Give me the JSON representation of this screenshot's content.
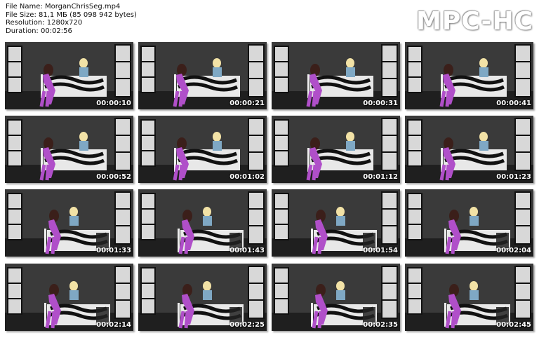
{
  "file_info": {
    "name": "File Name: MorganChrisSeg.mp4",
    "size": "File Size: 81,1 МБ (85 098 942 bytes)",
    "resolution": "Resolution: 1280x720",
    "duration": "Duration: 00:02:56"
  },
  "brand": "MPC-HC",
  "thumbnails": [
    {
      "time": "00:00:10"
    },
    {
      "time": "00:00:21"
    },
    {
      "time": "00:00:31"
    },
    {
      "time": "00:00:41"
    },
    {
      "time": "00:00:52"
    },
    {
      "time": "00:01:02"
    },
    {
      "time": "00:01:12"
    },
    {
      "time": "00:01:23"
    },
    {
      "time": "00:01:33"
    },
    {
      "time": "00:01:43"
    },
    {
      "time": "00:01:54"
    },
    {
      "time": "00:02:04"
    },
    {
      "time": "00:02:14"
    },
    {
      "time": "00:02:25"
    },
    {
      "time": "00:02:35"
    },
    {
      "time": "00:02:45"
    }
  ]
}
